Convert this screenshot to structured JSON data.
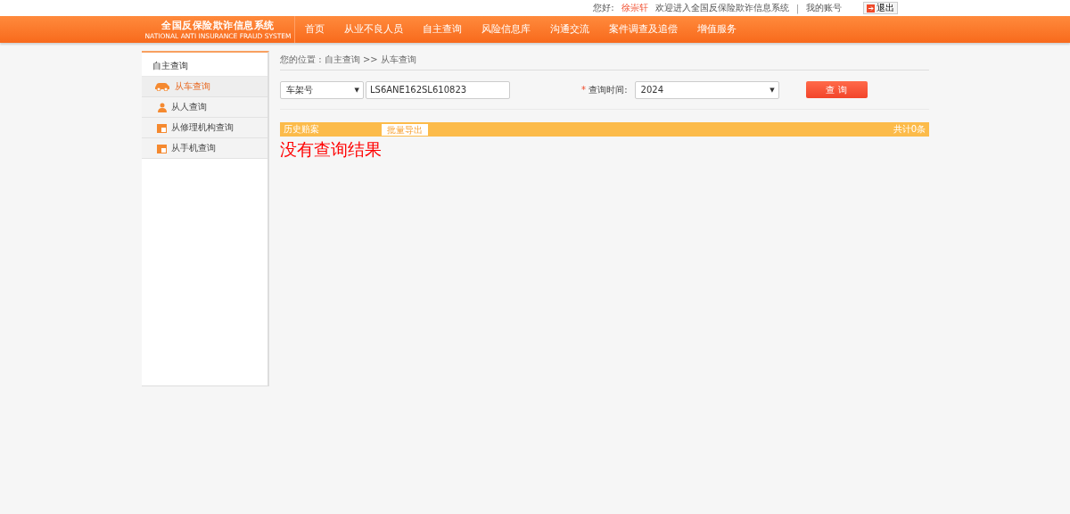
{
  "top_bar": {
    "greeting": "您好:",
    "username": "徐崇轩",
    "welcome": "欢迎进入全国反保险欺诈信息系统",
    "separator": "|",
    "account_link": "我的账号",
    "logout_button": "退出"
  },
  "logo": {
    "title": "全国反保险欺诈信息系统",
    "subtitle": "NATIONAL ANTI INSURANCE FRAUD SYSTEM"
  },
  "nav": [
    {
      "label": "首页",
      "selected": false
    },
    {
      "label": "从业不良人员",
      "selected": false
    },
    {
      "label": "自主查询",
      "selected": false
    },
    {
      "label": "风险信息库",
      "selected": false
    },
    {
      "label": "沟通交流",
      "selected": false
    },
    {
      "label": "案件调查及追偿",
      "selected": false
    },
    {
      "label": "增值服务",
      "selected": false
    }
  ],
  "sidebar": {
    "title": "自主查询",
    "items": [
      {
        "label": "从车查询",
        "kind": "car",
        "selected": true
      },
      {
        "label": "从人查询",
        "kind": "person",
        "selected": false
      },
      {
        "label": "从修理机构查询",
        "kind": "calendar",
        "selected": false
      },
      {
        "label": "从手机查询",
        "kind": "calendar",
        "selected": false
      }
    ]
  },
  "breadcrumb": "您的位置 : 自主查询 >> 从车查询",
  "search": {
    "type_select": "车架号",
    "dropdown_arrow": "▼",
    "vin_value": "LS6ANE162SL610823",
    "required_mark": "*",
    "time_label": "查询时间:",
    "time_select": "2024",
    "time_dropdown_arrow": "▼",
    "query_button": "查 询"
  },
  "results": {
    "title": "历史赔案",
    "export_button": "批量导出",
    "count": "共计0条",
    "empty_message": "没有查询结果"
  }
}
